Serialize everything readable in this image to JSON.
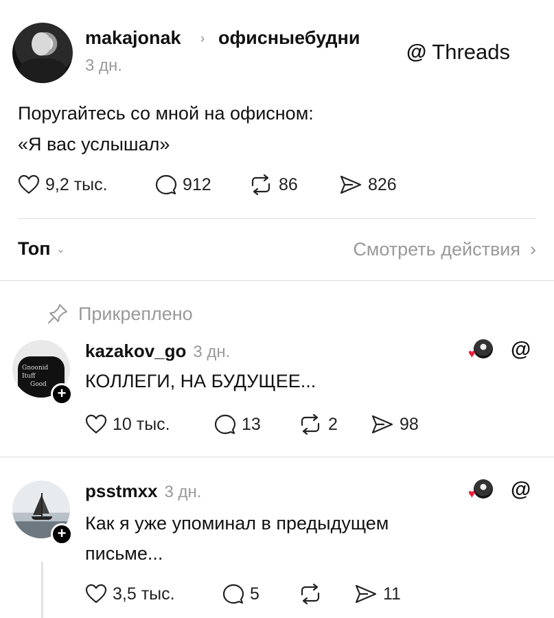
{
  "post": {
    "username": "makajonak",
    "separator": "›",
    "community": "офисныебудни",
    "time": "3 дн.",
    "brand_glyph": "@",
    "brand_name": "Threads",
    "text_line1": "Поругайтесь со мной на офисном:",
    "text_line2": "«Я вас услышал»",
    "likes": "9,2 тыс.",
    "replies": "912",
    "reposts": "86",
    "shares": "826"
  },
  "sort": {
    "label": "Топ",
    "chevron": "⌄",
    "view_activity": "Смотреть действия",
    "view_chevron": "›"
  },
  "pinned_label": "Прикреплено",
  "comments": [
    {
      "username": "kazakov_go",
      "time": "3 дн.",
      "text": "КОЛЛЕГИ, НА БУДУЩЕЕ...",
      "likes": "10 тыс.",
      "replies": "13",
      "reposts": "2",
      "shares": "98",
      "avatar_text": [
        "Gnoonid",
        "Ituff",
        "Good"
      ]
    },
    {
      "username": "psstmxx",
      "time": "3 дн.",
      "text_line1": "Как я уже упоминал в предыдущем",
      "text_line2": "письме...",
      "likes": "3,5 тыс.",
      "replies": "5",
      "reposts": "",
      "shares": "11"
    }
  ],
  "icons": {
    "heart": "heart-icon",
    "reply": "reply-icon",
    "repost": "repost-icon",
    "share": "share-icon",
    "pin": "pin-icon",
    "threads": "threads-icon"
  },
  "colors": {
    "accent_heart": "#f01e3a",
    "muted": "#999999",
    "text": "#111111"
  }
}
